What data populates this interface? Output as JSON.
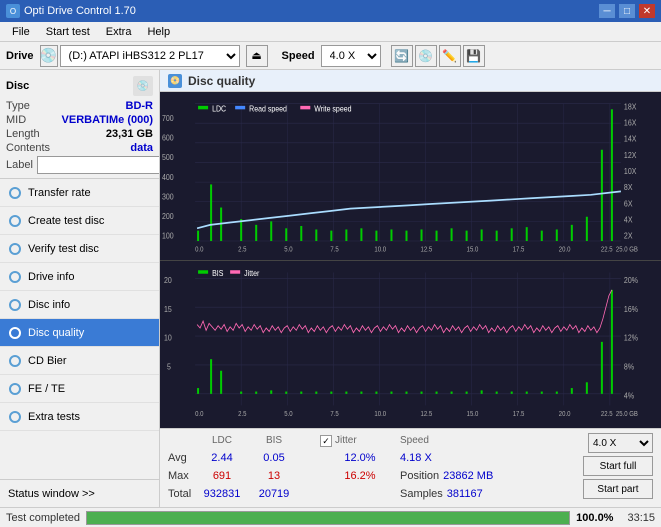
{
  "app": {
    "title": "Opti Drive Control 1.70",
    "icon": "O"
  },
  "titlebar": {
    "minimize": "─",
    "maximize": "□",
    "close": "✕"
  },
  "menu": {
    "items": [
      "File",
      "Start test",
      "Extra",
      "Help"
    ]
  },
  "drive_bar": {
    "label": "Drive",
    "drive_value": "(D:) ATAPI iHBS312  2 PL17",
    "speed_label": "Speed",
    "speed_value": "4.0 X"
  },
  "disc": {
    "label": "Disc",
    "type_key": "Type",
    "type_val": "BD-R",
    "mid_key": "MID",
    "mid_val": "VERBATIMe (000)",
    "length_key": "Length",
    "length_val": "23,31 GB",
    "contents_key": "Contents",
    "contents_val": "data",
    "label_key": "Label",
    "label_val": ""
  },
  "nav_items": [
    {
      "id": "transfer-rate",
      "label": "Transfer rate",
      "active": false
    },
    {
      "id": "create-test-disc",
      "label": "Create test disc",
      "active": false
    },
    {
      "id": "verify-test-disc",
      "label": "Verify test disc",
      "active": false
    },
    {
      "id": "drive-info",
      "label": "Drive info",
      "active": false
    },
    {
      "id": "disc-info",
      "label": "Disc info",
      "active": false
    },
    {
      "id": "disc-quality",
      "label": "Disc quality",
      "active": true
    },
    {
      "id": "cd-bier",
      "label": "CD Bier",
      "active": false
    },
    {
      "id": "fe-te",
      "label": "FE / TE",
      "active": false
    },
    {
      "id": "extra-tests",
      "label": "Extra tests",
      "active": false
    }
  ],
  "status_window": "Status window >>",
  "disc_quality": {
    "title": "Disc quality",
    "legend": {
      "ldc": "LDC",
      "read_speed": "Read speed",
      "write_speed": "Write speed"
    },
    "legend2": {
      "bis": "BIS",
      "jitter": "Jitter"
    }
  },
  "chart1": {
    "y_left_max": 700,
    "y_right_max": "18X",
    "y_right_labels": [
      "18X",
      "16X",
      "14X",
      "12X",
      "10X",
      "8X",
      "6X",
      "4X",
      "2X"
    ],
    "y_left_labels": [
      "700",
      "600",
      "500",
      "400",
      "300",
      "200",
      "100"
    ],
    "x_labels": [
      "0.0",
      "2.5",
      "5.0",
      "7.5",
      "10.0",
      "12.5",
      "15.0",
      "17.5",
      "20.0",
      "22.5",
      "25.0 GB"
    ]
  },
  "chart2": {
    "y_left_max": 20,
    "y_right_max": "20%",
    "y_right_labels": [
      "20%",
      "16%",
      "12%",
      "8%",
      "4%"
    ],
    "y_left_labels": [
      "20",
      "15",
      "10",
      "5"
    ],
    "x_labels": [
      "0.0",
      "2.5",
      "5.0",
      "7.5",
      "10.0",
      "12.5",
      "15.0",
      "17.5",
      "20.0",
      "22.5",
      "25.0 GB"
    ]
  },
  "stats": {
    "headers": [
      "LDC",
      "BIS",
      "",
      "Jitter",
      "Speed"
    ],
    "avg_label": "Avg",
    "avg_ldc": "2.44",
    "avg_bis": "0.05",
    "avg_jitter": "12.0%",
    "avg_speed": "4.18 X",
    "max_label": "Max",
    "max_ldc": "691",
    "max_bis": "13",
    "max_jitter": "16.2%",
    "total_label": "Total",
    "total_ldc": "932831",
    "total_bis": "20719",
    "speed_select": "4.0 X",
    "position_label": "Position",
    "position_val": "23862 MB",
    "samples_label": "Samples",
    "samples_val": "381167",
    "btn_start_full": "Start full",
    "btn_start_part": "Start part"
  },
  "progress": {
    "pct": "100.0%",
    "fill_pct": 100,
    "time": "33:15",
    "label": "Test completed"
  },
  "colors": {
    "ldc": "#00cc00",
    "read_speed": "#00aaff",
    "write_speed": "#ff69b4",
    "bis": "#00cc00",
    "jitter": "#ff69b4",
    "chart_bg": "#1a1a2e",
    "grid": "#2a2a4a",
    "accent_blue": "#0000cc",
    "accent_red": "#cc0000"
  }
}
